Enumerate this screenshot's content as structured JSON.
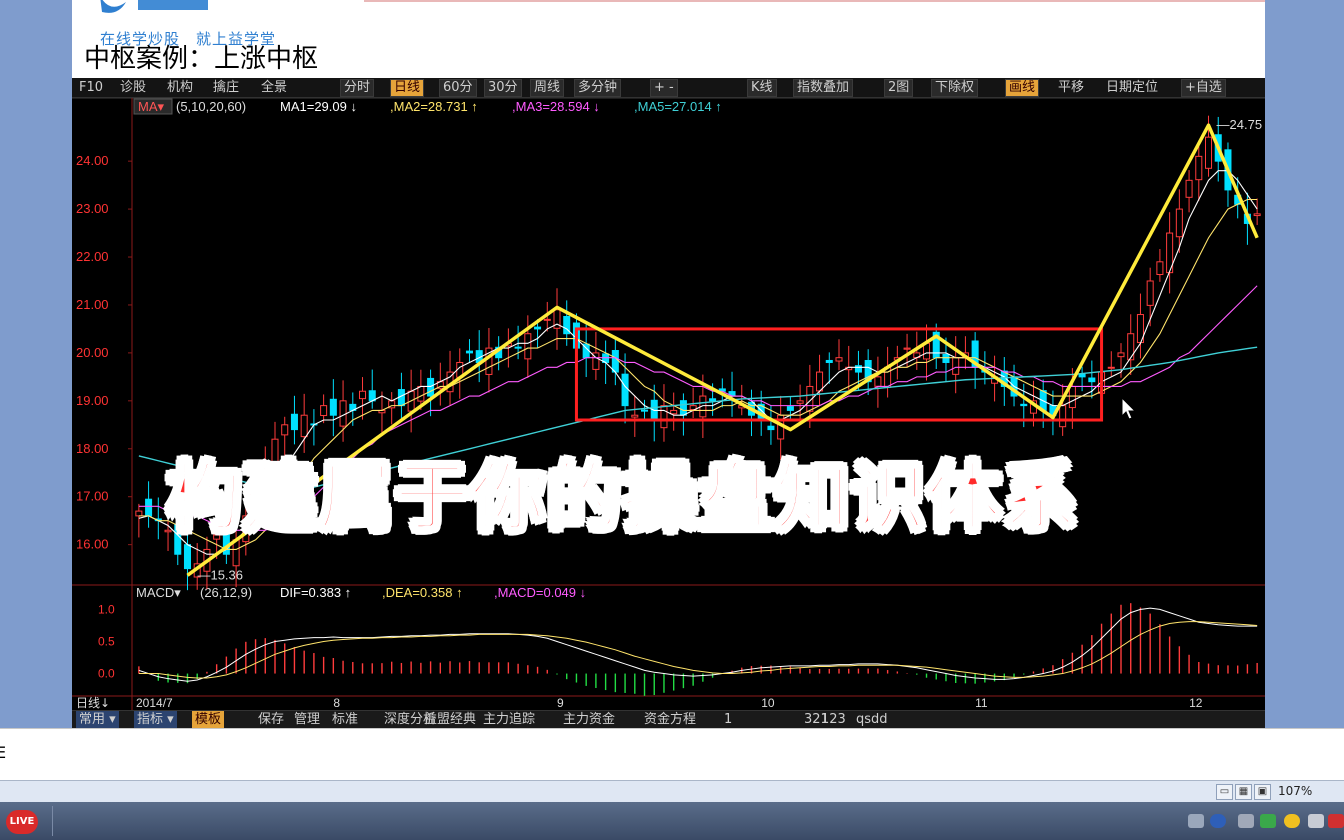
{
  "slide": {
    "logo_text": "益学堂",
    "logo_sub": "在线学炒股　就上益学堂",
    "title": "中枢案例：上涨中枢"
  },
  "toolbar": {
    "items": [
      {
        "label": "F10"
      },
      {
        "label": "诊股"
      },
      {
        "label": "机构"
      },
      {
        "label": "擒庄"
      },
      {
        "label": "全景"
      },
      {
        "label": "分时"
      },
      {
        "label": "日线",
        "active": true
      },
      {
        "label": "60分"
      },
      {
        "label": "30分"
      },
      {
        "label": "周线"
      },
      {
        "label": "多分钟"
      },
      {
        "label": "+ -"
      },
      {
        "label": "K线"
      },
      {
        "label": "指数叠加"
      },
      {
        "label": "2图"
      },
      {
        "label": "下除权"
      },
      {
        "label": "画线",
        "active": true
      },
      {
        "label": "平移"
      },
      {
        "label": "日期定位"
      },
      {
        "label": "+自选"
      }
    ]
  },
  "ma_legend": {
    "name": "MA",
    "params": "(5,10,20,60)",
    "ma1": "MA1=29.09 ↓",
    "ma2": ",MA2=28.731 ↑",
    "ma3": ",MA3=28.594 ↓",
    "ma5": ",MA5=27.014 ↑"
  },
  "macd_legend": {
    "name": "MACD",
    "params": "(26,12,9)",
    "dif": "DIF=0.383 ↑",
    "dea": ",DEA=0.358 ↑",
    "macd": ",MACD=0.049 ↓"
  },
  "price_labels": {
    "high": "24.75",
    "low": "15.36"
  },
  "period_label": "日线",
  "overlay_text": "构建属于你的操盘知识体系",
  "bottombar": {
    "items": [
      {
        "label": "常用",
        "dropdown": true
      },
      {
        "label": "指标",
        "dropdown": true
      },
      {
        "label": "模板",
        "active": true
      },
      {
        "label": "保存"
      },
      {
        "label": "管理"
      },
      {
        "label": "标准"
      },
      {
        "label": "深度分析"
      },
      {
        "label": "益盟经典"
      },
      {
        "label": "主力追踪"
      },
      {
        "label": "主力资金"
      },
      {
        "label": "资金方程"
      },
      {
        "label": "1"
      },
      {
        "label": "321"
      },
      {
        "label": "123"
      },
      {
        "label": "qsdd"
      }
    ]
  },
  "strip_char": "E",
  "status": {
    "zoom": "107%"
  },
  "taskbar": {
    "live_label": "LIVE"
  },
  "colors": {
    "up": "#ff3c3c",
    "down": "#00e0ff",
    "ma1": "#ffffff",
    "ma2": "#ffe46b",
    "ma3": "#ff5cff",
    "ma5": "#3fd0d6",
    "zigzag": "#ffeb3b",
    "box": "#ff2020"
  },
  "chart_data": [
    {
      "type": "candlestick",
      "y_ticks": [
        "24.00",
        "23.00",
        "22.00",
        "21.00",
        "20.00",
        "19.00",
        "18.00",
        "17.00",
        "16.00"
      ],
      "ylim": [
        15.2,
        24.9
      ],
      "x_ticks": [
        "2014/7",
        "8",
        "9",
        "10",
        "11",
        "12"
      ],
      "close": [
        16.7,
        16.6,
        16.5,
        16.3,
        15.8,
        15.5,
        15.6,
        15.9,
        16.2,
        15.8,
        16.1,
        16.6,
        17.0,
        17.6,
        18.2,
        18.5,
        18.4,
        18.7,
        18.5,
        18.9,
        18.7,
        19.0,
        18.8,
        19.2,
        19.0,
        18.8,
        19.0,
        18.9,
        19.2,
        19.3,
        19.1,
        19.4,
        19.6,
        19.8,
        20.0,
        19.8,
        20.1,
        19.9,
        20.2,
        20.1,
        20.4,
        20.5,
        20.7,
        20.9,
        20.4,
        20.1,
        19.9,
        20.0,
        19.8,
        19.6,
        18.9,
        18.7,
        18.8,
        18.6,
        18.9,
        18.8,
        18.7,
        18.9,
        19.1,
        19.0,
        19.2,
        19.1,
        18.9,
        18.7,
        18.6,
        18.4,
        18.7,
        18.8,
        19.0,
        19.3,
        19.6,
        19.8,
        19.9,
        19.7,
        19.6,
        19.4,
        19.5,
        19.7,
        19.9,
        20.1,
        20.0,
        20.2,
        19.9,
        19.8,
        19.9,
        20.0,
        19.7,
        19.6,
        19.5,
        19.3,
        19.1,
        18.9,
        19.0,
        18.8,
        18.7,
        18.9,
        19.3,
        19.5,
        19.4,
        19.6,
        19.7,
        20.0,
        20.4,
        20.8,
        21.5,
        21.9,
        22.5,
        23.0,
        23.6,
        24.1,
        24.5,
        24.0,
        23.4,
        23.1,
        22.7,
        22.9
      ],
      "series": [
        {
          "name": "MA1",
          "values": [
            16.55,
            16.6,
            16.5,
            16.4,
            16.2,
            16.0,
            15.9,
            15.8,
            15.8,
            15.9,
            16.1,
            16.3,
            16.5,
            16.8,
            17.2,
            17.6,
            17.9,
            18.2,
            18.5,
            18.6,
            18.6,
            18.7,
            18.8,
            18.9,
            19.0,
            19.1,
            19.0,
            19.1,
            19.2,
            19.3,
            19.3,
            19.4,
            19.5,
            19.7,
            19.8,
            19.9,
            20.0,
            20.1,
            20.1,
            20.2,
            20.2,
            20.3,
            20.5,
            20.6,
            20.5,
            20.3,
            20.1,
            19.9,
            19.8,
            19.6,
            19.3,
            19.1,
            18.9,
            18.8,
            18.8,
            18.7,
            18.7,
            18.8,
            18.9,
            18.9,
            19.0,
            19.1,
            19.1,
            19.0,
            18.8,
            18.6,
            18.6,
            18.7,
            18.8,
            19.0,
            19.2,
            19.4,
            19.6,
            19.7,
            19.7,
            19.7,
            19.6,
            19.6,
            19.7,
            19.8,
            19.9,
            20.0,
            20.0,
            20.0,
            19.9,
            19.9,
            19.8,
            19.7,
            19.6,
            19.5,
            19.3,
            19.2,
            19.1,
            19.0,
            18.9,
            18.9,
            19.0,
            19.1,
            19.2,
            19.4,
            19.5,
            19.6,
            19.9,
            20.2,
            20.7,
            21.2,
            21.7,
            22.2,
            22.8,
            23.2,
            23.6,
            23.8,
            23.8,
            23.6,
            23.3,
            23.0
          ]
        },
        {
          "name": "MA2",
          "values": [
            16.6,
            16.6,
            16.5,
            16.5,
            16.4,
            16.3,
            16.2,
            16.1,
            16.0,
            15.9,
            15.9,
            16.0,
            16.1,
            16.3,
            16.6,
            16.9,
            17.2,
            17.5,
            17.8,
            18.0,
            18.2,
            18.4,
            18.6,
            18.7,
            18.8,
            18.8,
            18.9,
            18.9,
            19.0,
            19.1,
            19.2,
            19.3,
            19.3,
            19.4,
            19.5,
            19.6,
            19.7,
            19.8,
            19.9,
            20.0,
            20.1,
            20.1,
            20.2,
            20.3,
            20.3,
            20.3,
            20.2,
            20.1,
            20.0,
            19.9,
            19.7,
            19.5,
            19.3,
            19.2,
            19.0,
            18.9,
            18.8,
            18.8,
            18.8,
            18.8,
            18.9,
            18.9,
            19.0,
            18.9,
            18.9,
            18.8,
            18.7,
            18.7,
            18.7,
            18.8,
            18.9,
            19.0,
            19.2,
            19.3,
            19.4,
            19.5,
            19.6,
            19.6,
            19.7,
            19.7,
            19.8,
            19.8,
            19.9,
            19.9,
            19.9,
            19.9,
            19.9,
            19.8,
            19.7,
            19.6,
            19.5,
            19.4,
            19.3,
            19.2,
            19.1,
            19.1,
            19.1,
            19.1,
            19.1,
            19.2,
            19.3,
            19.4,
            19.6,
            19.8,
            20.1,
            20.4,
            20.8,
            21.2,
            21.6,
            22.0,
            22.4,
            22.7,
            23.0,
            23.1,
            23.2,
            23.2
          ]
        },
        {
          "name": "MA3",
          "values": [
            16.8,
            16.8,
            16.8,
            16.7,
            16.7,
            16.6,
            16.6,
            16.5,
            16.4,
            16.4,
            16.3,
            16.3,
            16.3,
            16.3,
            16.4,
            16.5,
            16.6,
            16.8,
            17.0,
            17.2,
            17.4,
            17.6,
            17.8,
            18.0,
            18.1,
            18.3,
            18.4,
            18.5,
            18.6,
            18.7,
            18.8,
            18.8,
            18.9,
            19.0,
            19.1,
            19.1,
            19.2,
            19.3,
            19.4,
            19.4,
            19.5,
            19.6,
            19.7,
            19.7,
            19.8,
            19.8,
            19.9,
            19.9,
            19.9,
            19.9,
            19.8,
            19.8,
            19.7,
            19.6,
            19.6,
            19.5,
            19.4,
            19.3,
            19.3,
            19.2,
            19.2,
            19.1,
            19.1,
            19.0,
            19.0,
            18.9,
            18.9,
            18.9,
            18.9,
            18.9,
            18.9,
            19.0,
            19.0,
            19.1,
            19.1,
            19.2,
            19.3,
            19.3,
            19.4,
            19.4,
            19.5,
            19.5,
            19.6,
            19.6,
            19.7,
            19.7,
            19.7,
            19.7,
            19.7,
            19.6,
            19.6,
            19.5,
            19.5,
            19.4,
            19.4,
            19.3,
            19.3,
            19.3,
            19.3,
            19.3,
            19.3,
            19.3,
            19.4,
            19.4,
            19.5,
            19.6,
            19.7,
            19.9,
            20.0,
            20.2,
            20.4,
            20.6,
            20.8,
            21.0,
            21.2,
            21.4
          ]
        },
        {
          "name": "MA5",
          "values": [
            17.85,
            17.8,
            17.75,
            17.7,
            17.65,
            17.6,
            17.55,
            17.5,
            17.45,
            17.4,
            17.35,
            17.3,
            17.25,
            17.2,
            17.2,
            17.2,
            17.2,
            17.2,
            17.2,
            17.25,
            17.3,
            17.35,
            17.4,
            17.45,
            17.5,
            17.55,
            17.6,
            17.65,
            17.7,
            17.75,
            17.8,
            17.85,
            17.9,
            17.95,
            18.0,
            18.05,
            18.1,
            18.15,
            18.2,
            18.25,
            18.3,
            18.35,
            18.4,
            18.45,
            18.5,
            18.55,
            18.6,
            18.65,
            18.7,
            18.75,
            18.8,
            18.82,
            18.84,
            18.86,
            18.88,
            18.9,
            18.92,
            18.94,
            18.96,
            18.98,
            19.0,
            19.02,
            19.04,
            19.05,
            19.06,
            19.07,
            19.08,
            19.09,
            19.1,
            19.12,
            19.14,
            19.16,
            19.18,
            19.2,
            19.22,
            19.24,
            19.26,
            19.28,
            19.3,
            19.32,
            19.34,
            19.36,
            19.38,
            19.4,
            19.42,
            19.44,
            19.45,
            19.46,
            19.47,
            19.48,
            19.49,
            19.5,
            19.51,
            19.52,
            19.53,
            19.54,
            19.55,
            19.57,
            19.59,
            19.61,
            19.63,
            19.65,
            19.68,
            19.71,
            19.74,
            19.77,
            19.8,
            19.84,
            19.88,
            19.92,
            19.96,
            20.0,
            20.03,
            20.06,
            20.09,
            20.12
          ]
        }
      ],
      "zigzag": [
        {
          "i": 5,
          "v": 15.36
        },
        {
          "i": 43,
          "v": 20.95
        },
        {
          "i": 67,
          "v": 18.4
        },
        {
          "i": 82,
          "v": 20.35
        },
        {
          "i": 94,
          "v": 18.65
        },
        {
          "i": 110,
          "v": 24.75
        },
        {
          "i": 115,
          "v": 22.4
        }
      ],
      "box": {
        "i0": 45,
        "i1": 99,
        "v0": 18.6,
        "v1": 20.5
      }
    },
    {
      "type": "macd",
      "y_ticks": [
        "1.0",
        "0.5",
        "0.0"
      ],
      "ylim": [
        -0.35,
        1.1
      ],
      "dif": [
        0.05,
        0.0,
        -0.05,
        -0.08,
        -0.1,
        -0.12,
        -0.1,
        -0.05,
        0.02,
        0.1,
        0.2,
        0.3,
        0.38,
        0.45,
        0.5,
        0.52,
        0.54,
        0.55,
        0.56,
        0.56,
        0.57,
        0.56,
        0.56,
        0.56,
        0.56,
        0.57,
        0.58,
        0.58,
        0.59,
        0.59,
        0.6,
        0.6,
        0.61,
        0.61,
        0.62,
        0.62,
        0.62,
        0.62,
        0.62,
        0.61,
        0.6,
        0.58,
        0.55,
        0.5,
        0.45,
        0.4,
        0.35,
        0.3,
        0.25,
        0.2,
        0.15,
        0.1,
        0.05,
        0.02,
        0.0,
        -0.02,
        -0.03,
        -0.04,
        -0.03,
        -0.02,
        0.0,
        0.02,
        0.05,
        0.07,
        0.09,
        0.1,
        0.11,
        0.12,
        0.12,
        0.12,
        0.13,
        0.13,
        0.14,
        0.14,
        0.15,
        0.15,
        0.15,
        0.14,
        0.13,
        0.11,
        0.09,
        0.06,
        0.03,
        0.0,
        -0.03,
        -0.05,
        -0.07,
        -0.08,
        -0.09,
        -0.09,
        -0.08,
        -0.06,
        -0.03,
        0.0,
        0.04,
        0.1,
        0.18,
        0.28,
        0.4,
        0.55,
        0.7,
        0.85,
        0.95,
        1.0,
        1.02,
        1.0,
        0.95,
        0.9,
        0.85,
        0.8,
        0.78,
        0.76,
        0.75,
        0.74,
        0.74,
        0.74
      ],
      "dea": [
        0.0,
        0.0,
        0.0,
        -0.02,
        -0.04,
        -0.06,
        -0.07,
        -0.07,
        -0.05,
        -0.02,
        0.03,
        0.09,
        0.16,
        0.23,
        0.3,
        0.35,
        0.4,
        0.44,
        0.47,
        0.5,
        0.52,
        0.53,
        0.54,
        0.55,
        0.55,
        0.56,
        0.56,
        0.57,
        0.57,
        0.58,
        0.58,
        0.59,
        0.59,
        0.6,
        0.6,
        0.61,
        0.61,
        0.61,
        0.61,
        0.61,
        0.61,
        0.6,
        0.59,
        0.57,
        0.55,
        0.52,
        0.49,
        0.45,
        0.41,
        0.37,
        0.32,
        0.27,
        0.23,
        0.19,
        0.15,
        0.11,
        0.08,
        0.05,
        0.03,
        0.01,
        0.0,
        0.0,
        0.01,
        0.02,
        0.04,
        0.05,
        0.07,
        0.08,
        0.09,
        0.1,
        0.11,
        0.11,
        0.12,
        0.12,
        0.13,
        0.13,
        0.13,
        0.13,
        0.13,
        0.12,
        0.11,
        0.1,
        0.08,
        0.06,
        0.04,
        0.02,
        0.0,
        -0.02,
        -0.04,
        -0.05,
        -0.06,
        -0.06,
        -0.05,
        -0.04,
        -0.02,
        0.0,
        0.04,
        0.09,
        0.15,
        0.23,
        0.32,
        0.42,
        0.52,
        0.61,
        0.68,
        0.74,
        0.78,
        0.8,
        0.81,
        0.81,
        0.8,
        0.79,
        0.78,
        0.77,
        0.76,
        0.75
      ]
    }
  ]
}
